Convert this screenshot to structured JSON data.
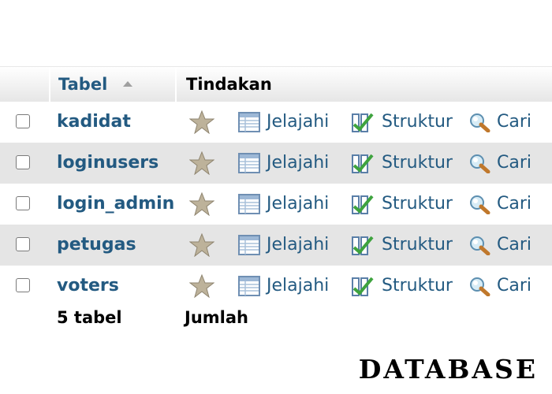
{
  "header": {
    "tabel_label": "Tabel",
    "tindakan_label": "Tindakan"
  },
  "rows": [
    {
      "name": "kadidat",
      "browse": "Jelajahi",
      "structure": "Struktur",
      "search": "Cari"
    },
    {
      "name": "loginusers",
      "browse": "Jelajahi",
      "structure": "Struktur",
      "search": "Cari"
    },
    {
      "name": "login_admin",
      "browse": "Jelajahi",
      "structure": "Struktur",
      "search": "Cari"
    },
    {
      "name": "petugas",
      "browse": "Jelajahi",
      "structure": "Struktur",
      "search": "Cari"
    },
    {
      "name": "voters",
      "browse": "Jelajahi",
      "structure": "Struktur",
      "search": "Cari"
    }
  ],
  "footer": {
    "count": "5 tabel",
    "sum_label": "Jumlah"
  },
  "watermark": "DATABASE",
  "icons": {
    "favorite": "star-icon",
    "browse": "browse-table-icon",
    "structure": "structure-icon",
    "search": "search-icon",
    "sort": "sort-ascending-icon"
  },
  "colors": {
    "link": "#235a81",
    "row_alt": "#e5e5e5"
  }
}
